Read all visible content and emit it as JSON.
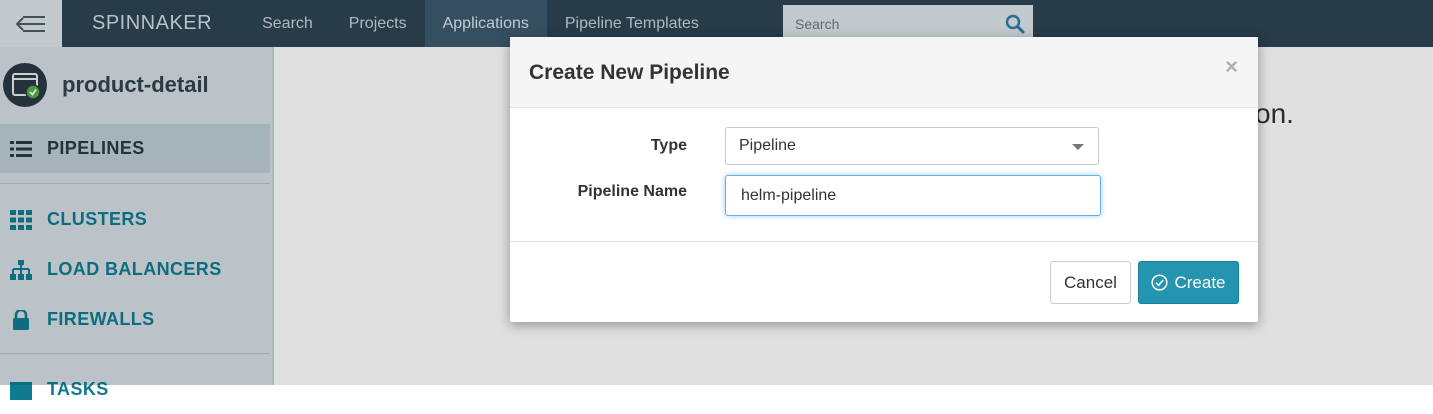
{
  "topnav": {
    "brand": "SPINNAKER",
    "items": [
      {
        "label": "Search"
      },
      {
        "label": "Projects"
      },
      {
        "label": "Applications",
        "active": true
      },
      {
        "label": "Pipeline Templates"
      }
    ],
    "search_placeholder": "Search"
  },
  "sidebar": {
    "app_name": "product-detail",
    "items": [
      {
        "label": "PIPELINES",
        "icon": "list-icon",
        "active": true
      },
      {
        "label": "CLUSTERS",
        "icon": "grid-icon"
      },
      {
        "label": "LOAD BALANCERS",
        "icon": "sitemap-icon"
      },
      {
        "label": "FIREWALLS",
        "icon": "lock-icon"
      },
      {
        "label": "TASKS",
        "icon": "tasks-icon"
      }
    ]
  },
  "main": {
    "behind_text": "on."
  },
  "modal": {
    "title": "Create New Pipeline",
    "close_label": "×",
    "type_label": "Type",
    "type_value": "Pipeline",
    "name_label": "Pipeline Name",
    "name_value": "helm-pipeline",
    "cancel_label": "Cancel",
    "create_label": "Create"
  },
  "colors": {
    "nav_bg": "#2d4453",
    "sidebar_bg": "#d6dfe4",
    "accent": "#0f7b90",
    "primary_button": "#2494b0"
  }
}
